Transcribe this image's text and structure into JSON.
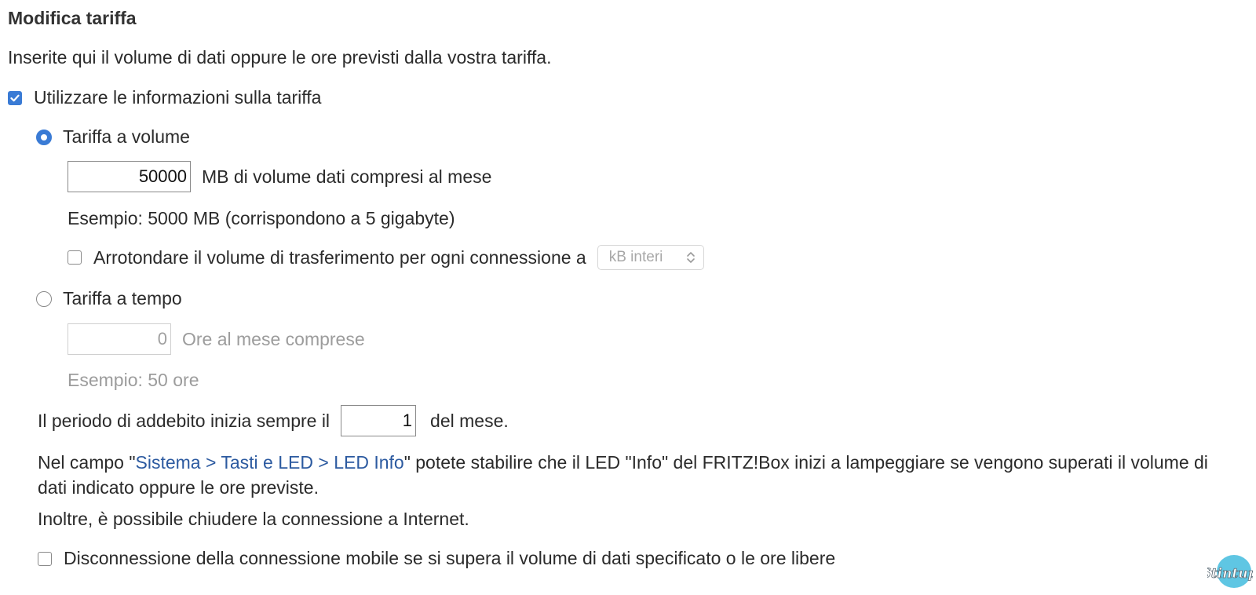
{
  "section_title": "Modifica tariffa",
  "intro_text": "Inserite qui il volume di dati oppure le ore previsti dalla vostra tariffa.",
  "use_tariff_info": {
    "label": "Utilizzare le informazioni sulla tariffa",
    "checked": true
  },
  "volume_tariff": {
    "label": "Tariffa a volume",
    "selected": true,
    "mb_value": "50000",
    "mb_label": "MB di volume dati compresi al mese",
    "example": "Esempio: 5000 MB (corrispondono a 5 gigabyte)",
    "round": {
      "label": "Arrotondare il volume di trasferimento per ogni connessione a",
      "checked": false,
      "selected_option": "kB interi"
    }
  },
  "time_tariff": {
    "label": "Tariffa a tempo",
    "selected": false,
    "hours_value": "0",
    "hours_label": "Ore al mese comprese",
    "example": "Esempio: 50 ore"
  },
  "billing": {
    "prefix": "Il periodo di addebito inizia sempre il",
    "day_value": "1",
    "suffix": "del mese."
  },
  "info": {
    "text_before": "Nel campo \"",
    "link_text": "Sistema > Tasti e LED > LED Info",
    "text_after": "\" potete stabilire che il LED \"Info\" del FRITZ!Box inizi a lampeggiare se vengono superati il volume di dati indicato oppure le ore previste.",
    "extra": "Inoltre, è possibile chiudere la connessione a Internet."
  },
  "disconnect": {
    "label": "Disconnessione della connessione mobile se si supera il volume di dati specificato o le ore libere",
    "checked": false
  },
  "watermark": "Stintup",
  "colors": {
    "accent": "#3a7bd5",
    "link": "#2c5aa0",
    "disabled": "#9c9c9c"
  }
}
